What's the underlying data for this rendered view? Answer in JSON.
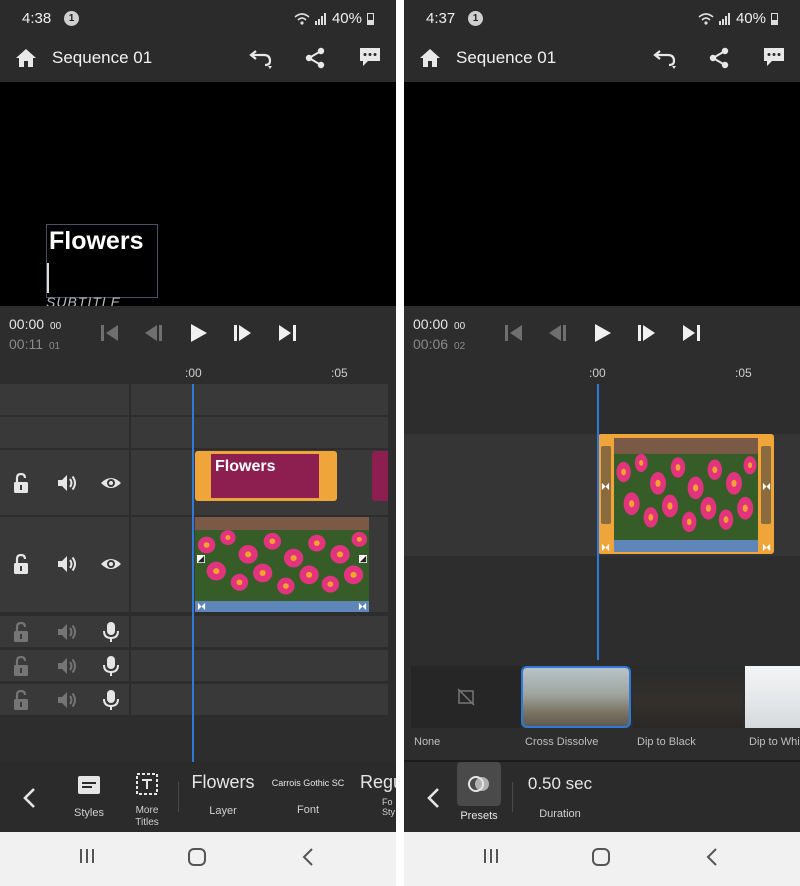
{
  "left": {
    "status": {
      "time": "4:38",
      "notification_count": "1",
      "battery": "40%"
    },
    "appbar": {
      "title": "Sequence 01"
    },
    "preview": {
      "title_text": "Flowers",
      "subtitle_text": "SUBTITLE"
    },
    "transport": {
      "current_time": "00:00",
      "current_frames": "00",
      "duration_time": "00:11",
      "duration_frames": "01"
    },
    "ruler": {
      "mark_0": ":00",
      "mark_5": ":05"
    },
    "clips": {
      "title_clip_label": "Flowers"
    },
    "toolbar": {
      "styles_label": "Styles",
      "more_titles_label": "More\nTitles",
      "layer_value": "Flowers",
      "layer_label": "Layer",
      "font_value": "Carrois Gothic SC",
      "font_label": "Font",
      "font_style_value": "Regu",
      "font_style_label": "Fo\nSty"
    }
  },
  "right": {
    "status": {
      "time": "4:37",
      "notification_count": "1",
      "battery": "40%"
    },
    "appbar": {
      "title": "Sequence 01"
    },
    "transport": {
      "current_time": "00:00",
      "current_frames": "00",
      "duration_time": "00:06",
      "duration_frames": "02"
    },
    "ruler": {
      "mark_0": ":00",
      "mark_5": ":05"
    },
    "transitions": [
      {
        "label": "None",
        "selected": false
      },
      {
        "label": "Cross Dissolve",
        "selected": true
      },
      {
        "label": "Dip to Black",
        "selected": false
      },
      {
        "label": "Dip to Whi",
        "selected": false
      }
    ],
    "toolbar": {
      "presets_label": "Presets",
      "duration_value": "0.50 sec",
      "duration_label": "Duration"
    }
  },
  "colors": {
    "accent_blue": "#2f7ad9",
    "clip_orange": "#f0a53a",
    "title_clip_magenta": "#8c1f4f",
    "waveform": "#5f86b8"
  },
  "icons": [
    "home-icon",
    "undo-icon",
    "share-icon",
    "chat-icon",
    "lock-icon",
    "speaker-icon",
    "eye-icon",
    "microphone-icon",
    "skip-back-icon",
    "step-back-icon",
    "play-icon",
    "step-forward-icon",
    "skip-forward-icon",
    "chevron-left-icon",
    "styles-icon",
    "more-titles-icon",
    "presets-icon",
    "recent-apps-icon",
    "home-nav-icon",
    "back-nav-icon"
  ]
}
